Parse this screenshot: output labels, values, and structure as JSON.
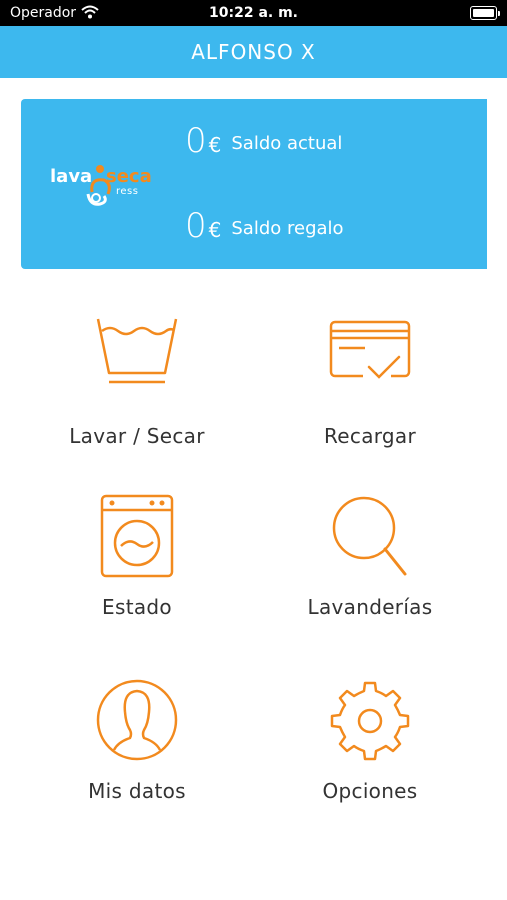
{
  "status_bar": {
    "carrier": "Operador",
    "time": "10:22 a. m."
  },
  "nav": {
    "title": "ALFONSO X"
  },
  "balance": {
    "logo": {
      "part1": "lava",
      "part2": "seca",
      "part3": "ress"
    },
    "current": {
      "amount": "0",
      "currency": "€",
      "label": "Saldo actual"
    },
    "gift": {
      "amount": "0",
      "currency": "€",
      "label": "Saldo regalo"
    }
  },
  "menu": {
    "wash": {
      "label": "Lavar / Secar",
      "icon": "wash-basin-icon"
    },
    "recharge": {
      "label": "Recargar",
      "icon": "credit-card-icon"
    },
    "status": {
      "label": "Estado",
      "icon": "washing-machine-icon"
    },
    "laundries": {
      "label": "Lavanderías",
      "icon": "search-icon"
    },
    "profile": {
      "label": "Mis datos",
      "icon": "user-icon"
    },
    "options": {
      "label": "Opciones",
      "icon": "gear-icon"
    }
  },
  "colors": {
    "primary": "#3db8ee",
    "accent": "#f28a1e",
    "text": "#333333"
  }
}
